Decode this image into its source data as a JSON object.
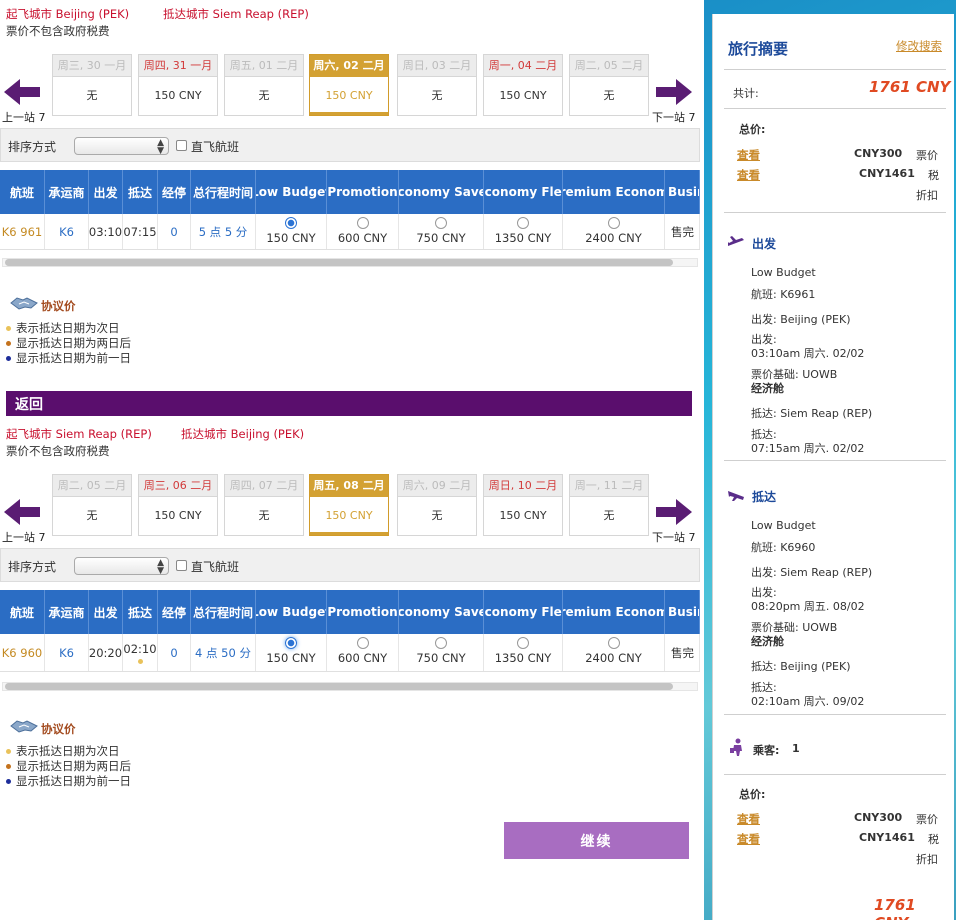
{
  "outbound": {
    "origin": "起飞城市 Beijing (PEK)",
    "destination": "抵达城市 Siem Reap (REP)",
    "tax_note": "票价不包含政府税费",
    "prev_label": "上一站 7",
    "next_label": "下一站 7",
    "dates": [
      {
        "header": "周三, 30 一月",
        "price": "无",
        "state": "none"
      },
      {
        "header": "周四, 31 一月",
        "price": "150 CNY",
        "state": "weekend"
      },
      {
        "header": "周五, 01 二月",
        "price": "无",
        "state": "none"
      },
      {
        "header": "周六, 02 二月",
        "price": "150 CNY",
        "state": "selected"
      },
      {
        "header": "周日, 03 二月",
        "price": "无",
        "state": "none"
      },
      {
        "header": "周一, 04 二月",
        "price": "150 CNY",
        "state": "weekend"
      },
      {
        "header": "周二, 05 二月",
        "price": "无",
        "state": "none"
      }
    ],
    "sort_label": "排序方式",
    "direct_label": "直飞航班",
    "columns": [
      "航班",
      "承运商",
      "出发",
      "抵达",
      "经停",
      "总行程时间",
      "Low Budget",
      "Promotion",
      "Economy Saver",
      "Economy Flex",
      "Premium Economy",
      "Busin"
    ],
    "row": {
      "flight": "K6 961",
      "carrier": "K6",
      "depart": "03:10",
      "arrive": "07:15",
      "stops": "0",
      "duration": "5 点 5 分",
      "fares": [
        "150 CNY",
        "600 CNY",
        "750 CNY",
        "1350 CNY",
        "2400 CNY",
        "售完"
      ]
    },
    "agreement_label": "协议价",
    "legend": [
      "表示抵达日期为次日",
      "显示抵达日期为两日后",
      "显示抵达日期为前一日"
    ]
  },
  "return": {
    "bar_title": "返回",
    "origin": "起飞城市 Siem Reap (REP)",
    "destination": "抵达城市 Beijing (PEK)",
    "tax_note": "票价不包含政府税费",
    "prev_label": "上一站 7",
    "next_label": "下一站 7",
    "dates": [
      {
        "header": "周二, 05 二月",
        "price": "无",
        "state": "none"
      },
      {
        "header": "周三, 06 二月",
        "price": "150 CNY",
        "state": "weekend"
      },
      {
        "header": "周四, 07 二月",
        "price": "无",
        "state": "none"
      },
      {
        "header": "周五, 08 二月",
        "price": "150 CNY",
        "state": "selected"
      },
      {
        "header": "周六, 09 二月",
        "price": "无",
        "state": "none"
      },
      {
        "header": "周日, 10 二月",
        "price": "150 CNY",
        "state": "weekend"
      },
      {
        "header": "周一, 11 二月",
        "price": "无",
        "state": "none"
      }
    ],
    "sort_label": "排序方式",
    "direct_label": "直飞航班",
    "columns": [
      "航班",
      "承运商",
      "出发",
      "抵达",
      "经停",
      "总行程时间",
      "Low Budget",
      "Promotion",
      "Economy Saver",
      "Economy Flex",
      "Premium Economy",
      "Busin"
    ],
    "row": {
      "flight": "K6 960",
      "carrier": "K6",
      "depart": "20:20",
      "arrive": "02:10",
      "stops": "0",
      "duration": "4 点 50 分",
      "fares": [
        "150 CNY",
        "600 CNY",
        "750 CNY",
        "1350 CNY",
        "2400 CNY",
        "售完"
      ]
    },
    "agreement_label": "协议价",
    "legend": [
      "表示抵达日期为次日",
      "显示抵达日期为两日后",
      "显示抵达日期为前一日"
    ]
  },
  "continue_label": "继续",
  "summary": {
    "title": "旅行摘要",
    "modify_link": "修改搜索",
    "total_label": "共计:",
    "total_value": "1761 CNY",
    "price_label": "总价:",
    "view_label": "查看",
    "fare_amount": "CNY300",
    "fare_label": "票价",
    "tax_amount": "CNY1461",
    "tax_label": "税",
    "discount_label": "折扣",
    "depart_section": "出发",
    "arrive_section": "抵达",
    "outbound": {
      "fare_type": "Low Budget",
      "flight": "航班:  K6961",
      "from": "出发:  Beijing (PEK)",
      "dep_label": "出发:",
      "dep_time": "03:10am 周六. 02/02",
      "basis": "票价基础:  UOWB",
      "cabin": "经济舱",
      "to": "抵达:  Siem Reap (REP)",
      "arr_label": "抵达:",
      "arr_time": "07:15am 周六. 02/02"
    },
    "inbound": {
      "fare_type": "Low Budget",
      "flight": "航班:  K6960",
      "from": "出发:  Siem Reap (REP)",
      "dep_label": "出发:",
      "dep_time": "08:20pm 周五. 08/02",
      "basis": "票价基础:  UOWB",
      "cabin": "经济舱",
      "to": "抵达:  Beijing (PEK)",
      "arr_label": "抵达:",
      "arr_time": "02:10am 周六. 09/02"
    },
    "passengers_label": "乘客:",
    "passengers_value": "1",
    "colors": {
      "accent": "#2b6dc4",
      "selected": "#d3a133",
      "total": "#e04a22",
      "purple": "#5a0e6d"
    }
  }
}
